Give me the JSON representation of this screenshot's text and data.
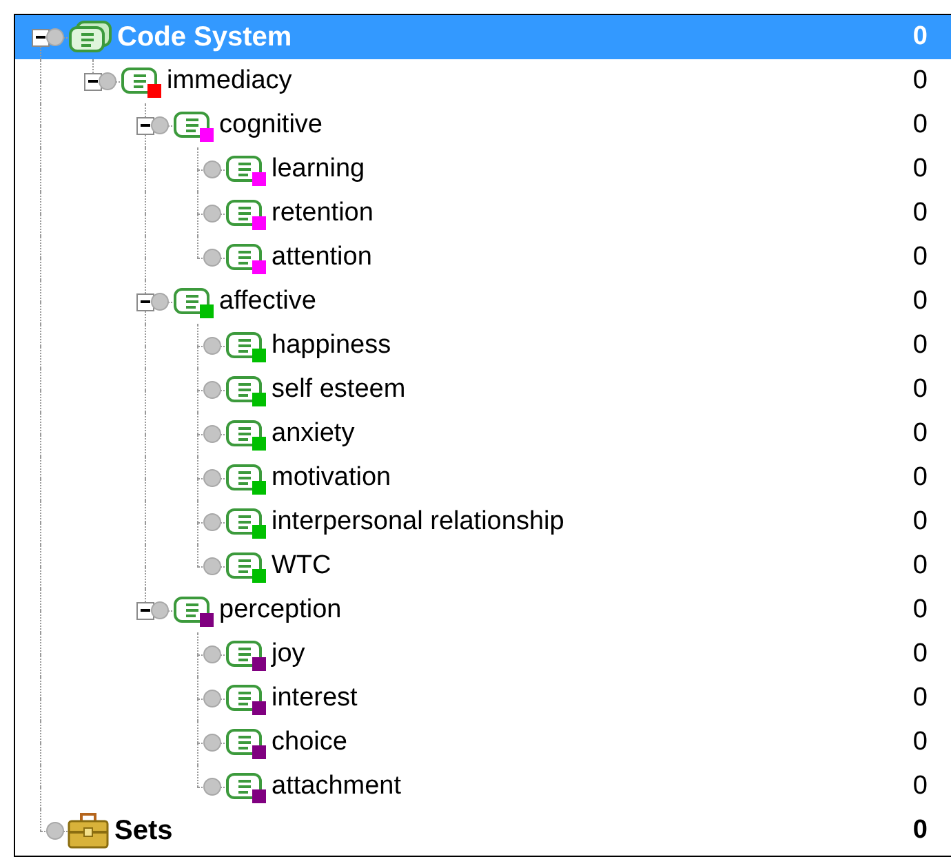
{
  "tree": [
    {
      "kind": "root",
      "label": "Code System",
      "count": "0",
      "selected": true,
      "expanded": true,
      "children": [
        {
          "kind": "code",
          "label": "immediacy",
          "count": "0",
          "selected": false,
          "color": "#ff0000",
          "expanded": true,
          "children": [
            {
              "kind": "code",
              "label": "cognitive",
              "count": "0",
              "selected": false,
              "color": "#ff00ff",
              "expanded": true,
              "children": [
                {
                  "kind": "code",
                  "label": "learning",
                  "count": "0",
                  "selected": false,
                  "color": "#ff00ff"
                },
                {
                  "kind": "code",
                  "label": "retention",
                  "count": "0",
                  "selected": false,
                  "color": "#ff00ff"
                },
                {
                  "kind": "code",
                  "label": "attention",
                  "count": "0",
                  "selected": false,
                  "color": "#ff00ff"
                }
              ]
            },
            {
              "kind": "code",
              "label": "affective",
              "count": "0",
              "selected": false,
              "color": "#00c000",
              "expanded": true,
              "children": [
                {
                  "kind": "code",
                  "label": "happiness",
                  "count": "0",
                  "selected": false,
                  "color": "#00c000"
                },
                {
                  "kind": "code",
                  "label": "self esteem",
                  "count": "0",
                  "selected": false,
                  "color": "#00c000"
                },
                {
                  "kind": "code",
                  "label": "anxiety",
                  "count": "0",
                  "selected": false,
                  "color": "#00c000"
                },
                {
                  "kind": "code",
                  "label": "motivation",
                  "count": "0",
                  "selected": false,
                  "color": "#00c000"
                },
                {
                  "kind": "code",
                  "label": "interpersonal relationship",
                  "count": "0",
                  "selected": false,
                  "color": "#00c000"
                },
                {
                  "kind": "code",
                  "label": "WTC",
                  "count": "0",
                  "selected": false,
                  "color": "#00c000"
                }
              ]
            },
            {
              "kind": "code",
              "label": "perception",
              "count": "0",
              "selected": false,
              "color": "#800080",
              "expanded": true,
              "children": [
                {
                  "kind": "code",
                  "label": "joy",
                  "count": "0",
                  "selected": false,
                  "color": "#800080"
                },
                {
                  "kind": "code",
                  "label": "interest",
                  "count": "0",
                  "selected": false,
                  "color": "#800080"
                },
                {
                  "kind": "code",
                  "label": "choice",
                  "count": "0",
                  "selected": false,
                  "color": "#800080"
                },
                {
                  "kind": "code",
                  "label": "attachment",
                  "count": "0",
                  "selected": false,
                  "color": "#800080"
                }
              ]
            }
          ]
        }
      ]
    },
    {
      "kind": "sets",
      "label": "Sets",
      "count": "0",
      "selected": false
    }
  ]
}
